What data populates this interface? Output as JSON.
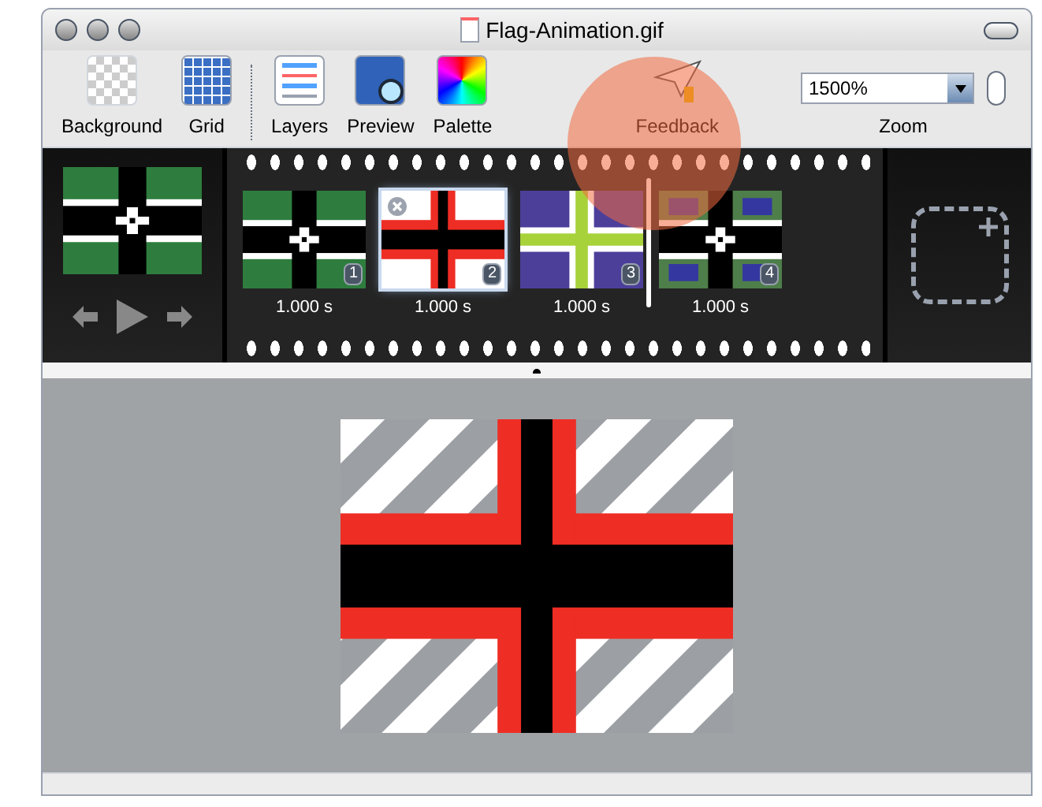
{
  "window": {
    "title": "Flag-Animation.gif"
  },
  "toolbar": {
    "items": [
      {
        "label": "Background",
        "kind": "background"
      },
      {
        "label": "Grid",
        "kind": "grid"
      },
      {
        "label": "Layers",
        "kind": "layers"
      },
      {
        "label": "Preview",
        "kind": "preview"
      },
      {
        "label": "Palette",
        "kind": "palette"
      },
      {
        "label": "Feedback",
        "kind": "feedback"
      }
    ],
    "zoom": {
      "value": "1500%",
      "label": "Zoom"
    }
  },
  "preview": {
    "kind": "green"
  },
  "frames": [
    {
      "kind": "green",
      "number": "1",
      "duration": "1.000 s",
      "selected": false
    },
    {
      "kind": "red",
      "number": "2",
      "duration": "1.000 s",
      "selected": true
    },
    {
      "kind": "purple",
      "number": "3",
      "duration": "1.000 s",
      "selected": false
    },
    {
      "kind": "mixed",
      "number": "4",
      "duration": "1.000 s",
      "selected": false
    }
  ],
  "canvas": {
    "kind": "red"
  }
}
